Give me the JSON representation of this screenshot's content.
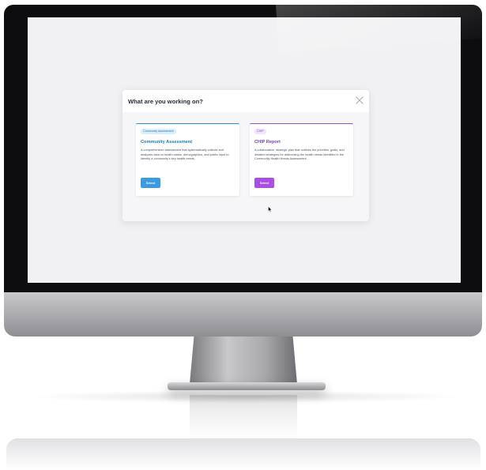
{
  "modal": {
    "title": "What are you working on?",
    "close_icon": "close-icon"
  },
  "cards": [
    {
      "badge": "Community Assessment",
      "title": "Community Assessment",
      "description": "A comprehensive assessment that systematically collects and analyzes data on health status, demographics, and public input to identify a community's key health needs.",
      "button_label": "Select",
      "accent_color": "#2b8fd6"
    },
    {
      "badge": "CHIP",
      "title": "CHIP Report",
      "description": "A collaborative, strategic plan that outlines the priorities, goals, and detailed strategies for addressing the health needs identified in the Community Health Needs Assessment.",
      "button_label": "Select",
      "accent_color": "#8d55c9"
    }
  ],
  "colors": {
    "screen_background": "#f1f1f3",
    "monitor_bezel": "#0d0d0f"
  },
  "cursor_icon": "mouse-pointer-icon"
}
